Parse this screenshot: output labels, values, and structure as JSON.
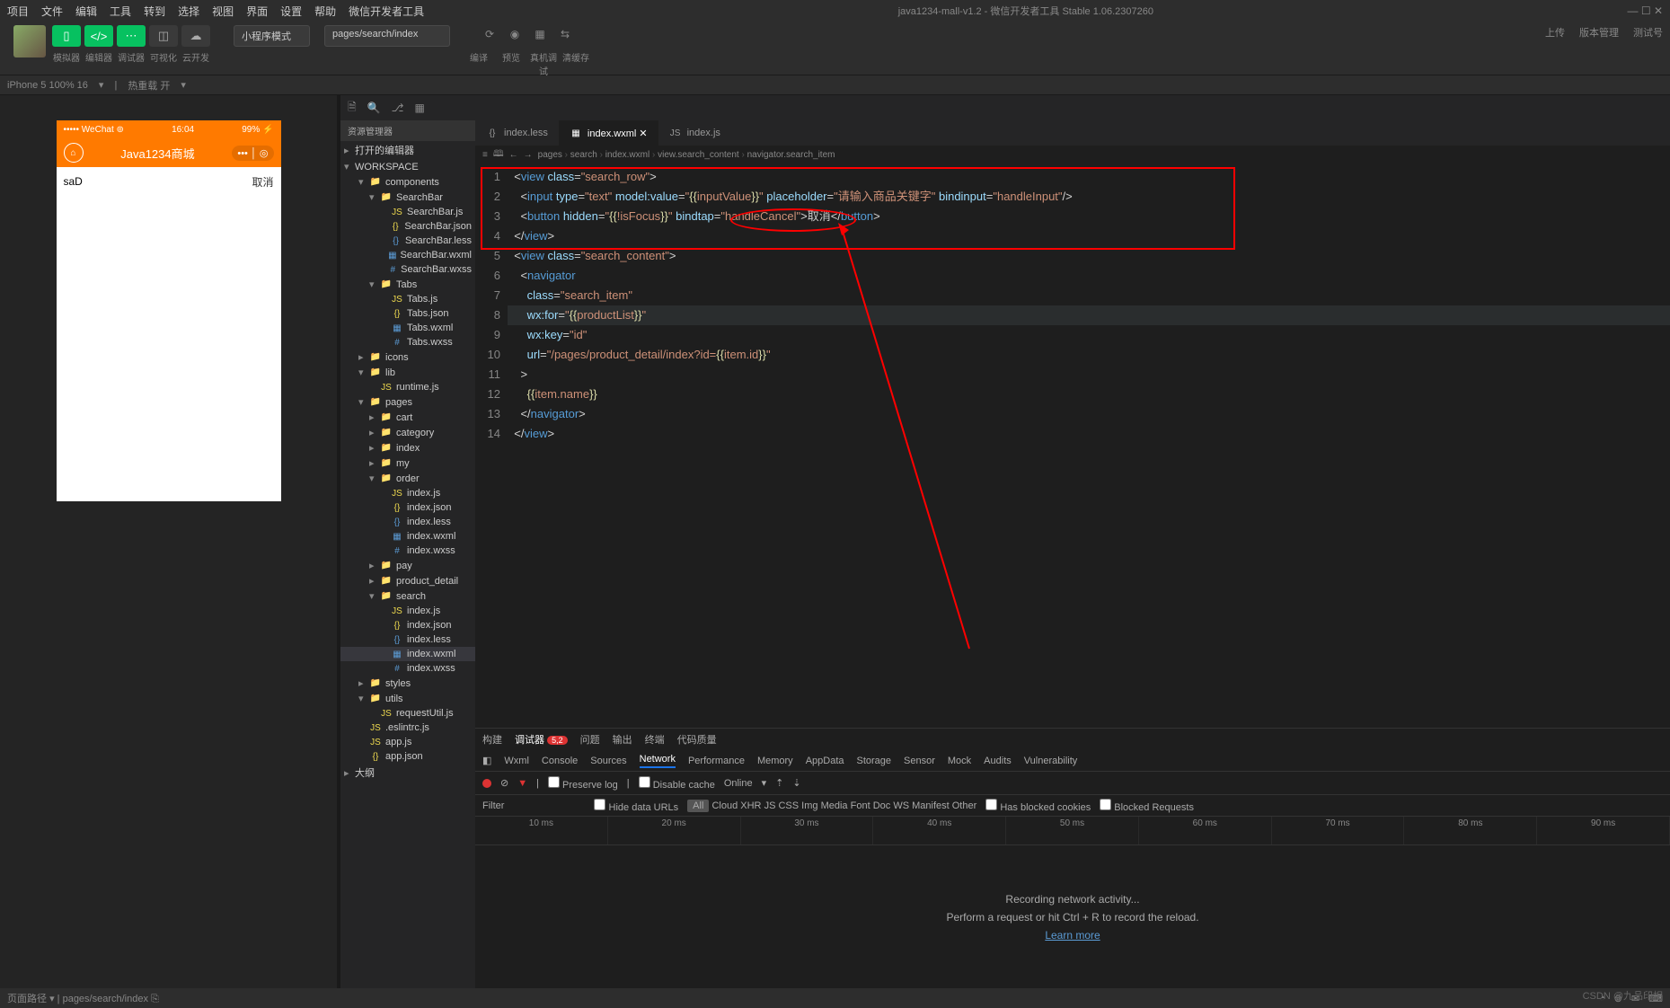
{
  "title": {
    "project": "java1234-mall-v1.2",
    "app": "微信开发者工具 Stable 1.06.2307260"
  },
  "menubar": [
    "项目",
    "文件",
    "编辑",
    "工具",
    "转到",
    "选择",
    "视图",
    "界面",
    "设置",
    "帮助",
    "微信开发者工具"
  ],
  "toolbar": {
    "left_labels": [
      "模拟器",
      "编辑器",
      "调试器",
      "可视化",
      "云开发"
    ],
    "mode_select": "小程序模式",
    "page_select": "pages/search/index",
    "action_labels": [
      "编译",
      "预览",
      "真机调试",
      "清缓存"
    ],
    "right": [
      "上传",
      "版本管理",
      "测试号"
    ]
  },
  "statusbar": {
    "device": "iPhone 5 100% 16",
    "hot": "热重载 开"
  },
  "simulator": {
    "carrier": "••••• WeChat",
    "wifi": "⊚",
    "time": "16:04",
    "battery": "99% ⚡",
    "back": "⟨",
    "title": "Java1234商城",
    "search_value": "saD",
    "cancel": "取消"
  },
  "explorer": {
    "title": "资源管理器",
    "section1": "打开的编辑器",
    "section2": "WORKSPACE",
    "tree": [
      {
        "l": 1,
        "t": "fold",
        "n": "components",
        "open": true
      },
      {
        "l": 2,
        "t": "fold",
        "n": "SearchBar",
        "open": true
      },
      {
        "l": 3,
        "t": "js",
        "n": "SearchBar.js"
      },
      {
        "l": 3,
        "t": "json",
        "n": "SearchBar.json"
      },
      {
        "l": 3,
        "t": "less",
        "n": "SearchBar.less"
      },
      {
        "l": 3,
        "t": "wxml",
        "n": "SearchBar.wxml"
      },
      {
        "l": 3,
        "t": "wxss",
        "n": "SearchBar.wxss"
      },
      {
        "l": 2,
        "t": "fold",
        "n": "Tabs",
        "open": true
      },
      {
        "l": 3,
        "t": "js",
        "n": "Tabs.js"
      },
      {
        "l": 3,
        "t": "json",
        "n": "Tabs.json"
      },
      {
        "l": 3,
        "t": "wxml",
        "n": "Tabs.wxml"
      },
      {
        "l": 3,
        "t": "wxss",
        "n": "Tabs.wxss"
      },
      {
        "l": 1,
        "t": "fold",
        "n": "icons",
        "open": false
      },
      {
        "l": 1,
        "t": "fold",
        "n": "lib",
        "open": true
      },
      {
        "l": 2,
        "t": "js",
        "n": "runtime.js"
      },
      {
        "l": 1,
        "t": "fold",
        "n": "pages",
        "open": true
      },
      {
        "l": 2,
        "t": "fold",
        "n": "cart",
        "open": false
      },
      {
        "l": 2,
        "t": "fold",
        "n": "category",
        "open": false
      },
      {
        "l": 2,
        "t": "fold",
        "n": "index",
        "open": false
      },
      {
        "l": 2,
        "t": "fold",
        "n": "my",
        "open": false
      },
      {
        "l": 2,
        "t": "fold",
        "n": "order",
        "open": true
      },
      {
        "l": 3,
        "t": "js",
        "n": "index.js"
      },
      {
        "l": 3,
        "t": "json",
        "n": "index.json"
      },
      {
        "l": 3,
        "t": "less",
        "n": "index.less"
      },
      {
        "l": 3,
        "t": "wxml",
        "n": "index.wxml"
      },
      {
        "l": 3,
        "t": "wxss",
        "n": "index.wxss"
      },
      {
        "l": 2,
        "t": "fold",
        "n": "pay",
        "open": false
      },
      {
        "l": 2,
        "t": "fold",
        "n": "product_detail",
        "open": false
      },
      {
        "l": 2,
        "t": "fold",
        "n": "search",
        "open": true
      },
      {
        "l": 3,
        "t": "js",
        "n": "index.js"
      },
      {
        "l": 3,
        "t": "json",
        "n": "index.json"
      },
      {
        "l": 3,
        "t": "less",
        "n": "index.less"
      },
      {
        "l": 3,
        "t": "wxml",
        "n": "index.wxml",
        "active": true
      },
      {
        "l": 3,
        "t": "wxss",
        "n": "index.wxss"
      },
      {
        "l": 1,
        "t": "fold",
        "n": "styles",
        "open": false
      },
      {
        "l": 1,
        "t": "fold",
        "n": "utils",
        "open": true
      },
      {
        "l": 2,
        "t": "js",
        "n": "requestUtil.js"
      },
      {
        "l": 1,
        "t": "js",
        "n": ".eslintrc.js"
      },
      {
        "l": 1,
        "t": "js",
        "n": "app.js"
      },
      {
        "l": 1,
        "t": "json",
        "n": "app.json"
      }
    ],
    "outline": "大纲"
  },
  "editor": {
    "tabs": [
      {
        "name": "index.less",
        "icon": "{}",
        "active": false
      },
      {
        "name": "index.wxml",
        "icon": "▦",
        "active": true
      },
      {
        "name": "index.js",
        "icon": "JS",
        "active": false
      }
    ],
    "crumbs": [
      "pages",
      "search",
      "index.wxml",
      "view.search_content",
      "navigator.search_item"
    ],
    "lines": [
      {
        "n": 1,
        "html": "<span class='t-text'>&lt;</span><span class='t-tag'>view</span> <span class='t-attr'>class</span>=<span class='t-str'>\"search_row\"</span><span class='t-text'>&gt;</span>"
      },
      {
        "n": 2,
        "html": "  <span class='t-text'>&lt;</span><span class='t-tag'>input</span> <span class='t-attr'>type</span>=<span class='t-str'>\"text\"</span> <span class='t-attr'>model:value</span>=<span class='t-str'>\"</span><span class='t-brace'>{{</span><span class='t-str'>inputValue</span><span class='t-brace'>}}</span><span class='t-str'>\"</span> <span class='t-attr'>placeholder</span>=<span class='t-str'>\"请输入商品关键字\"</span> <span class='t-attr'>bindinput</span>=<span class='t-str'>\"handleInput\"</span><span class='t-text'>/&gt;</span>"
      },
      {
        "n": 3,
        "html": "  <span class='t-text'>&lt;</span><span class='t-tag'>button</span> <span class='t-attr'>hidden</span>=<span class='t-str'>\"</span><span class='t-brace'>{{</span><span class='t-str'>!isFocus</span><span class='t-brace'>}}</span><span class='t-str'>\"</span> <span class='t-attr'>bindtap</span>=<span class='t-str'>\"handleCancel\"</span><span class='t-text'>&gt;</span>取消<span class='t-text'>&lt;/</span><span class='t-tag'>button</span><span class='t-text'>&gt;</span>"
      },
      {
        "n": 4,
        "html": "<span class='t-text'>&lt;/</span><span class='t-tag'>view</span><span class='t-text'>&gt;</span>"
      },
      {
        "n": 5,
        "html": "<span class='t-text'>&lt;</span><span class='t-tag'>view</span> <span class='t-attr'>class</span>=<span class='t-str'>\"search_content\"</span><span class='t-text'>&gt;</span>"
      },
      {
        "n": 6,
        "html": "  <span class='t-text'>&lt;</span><span class='t-tag'>navigator</span>"
      },
      {
        "n": 7,
        "html": "    <span class='t-attr'>class</span>=<span class='t-str'>\"search_item\"</span>"
      },
      {
        "n": 8,
        "html": "    <span class='t-attr'>wx:for</span>=<span class='t-str'>\"</span><span class='t-brace'>{{</span><span class='t-str'>productList</span><span class='t-brace'>}}</span><span class='t-str'>\"</span>",
        "hl": true
      },
      {
        "n": 9,
        "html": "    <span class='t-attr'>wx:key</span>=<span class='t-str'>\"id\"</span>"
      },
      {
        "n": 10,
        "html": "    <span class='t-attr'>url</span>=<span class='t-str'>\"/pages/product_detail/index?id=</span><span class='t-brace'>{{</span><span class='t-str'>item.id</span><span class='t-brace'>}}</span><span class='t-str'>\"</span>"
      },
      {
        "n": 11,
        "html": "  <span class='t-text'>&gt;</span>"
      },
      {
        "n": 12,
        "html": "    <span class='t-brace'>{{</span><span class='t-str'>item.name</span><span class='t-brace'>}}</span>"
      },
      {
        "n": 13,
        "html": "  <span class='t-text'>&lt;/</span><span class='t-tag'>navigator</span><span class='t-text'>&gt;</span>"
      },
      {
        "n": 14,
        "html": "<span class='t-text'>&lt;/</span><span class='t-tag'>view</span><span class='t-text'>&gt;</span>"
      }
    ]
  },
  "devtools": {
    "row1": [
      "构建",
      "调试器",
      "问题",
      "输出",
      "终端",
      "代码质量"
    ],
    "row1_badge": "5,2",
    "row2": [
      "Wxml",
      "Console",
      "Sources",
      "Network",
      "Performance",
      "Memory",
      "AppData",
      "Storage",
      "Sensor",
      "Mock",
      "Audits",
      "Vulnerability"
    ],
    "bar": {
      "preserve": "Preserve log",
      "disable": "Disable cache",
      "online": "Online"
    },
    "filter": {
      "label": "Filter",
      "hide": "Hide data URLs",
      "types": [
        "All",
        "Cloud",
        "XHR",
        "JS",
        "CSS",
        "Img",
        "Media",
        "Font",
        "Doc",
        "WS",
        "Manifest",
        "Other"
      ],
      "blocked_cookies": "Has blocked cookies",
      "blocked_req": "Blocked Requests"
    },
    "timeline": [
      "10 ms",
      "20 ms",
      "30 ms",
      "40 ms",
      "50 ms",
      "60 ms",
      "70 ms",
      "80 ms",
      "90 ms"
    ],
    "recording": "Recording network activity...",
    "hint": "Perform a request or hit Ctrl + R to record the reload.",
    "learn": "Learn more"
  },
  "footer": {
    "left_label": "页面路径",
    "path": "pages/search/index"
  },
  "watermark": "CSDN @九品印相"
}
